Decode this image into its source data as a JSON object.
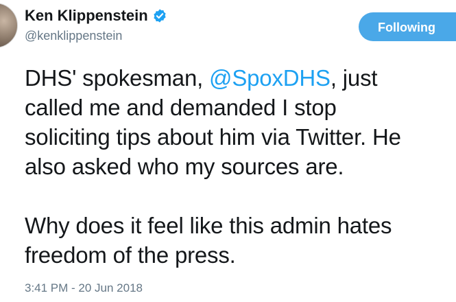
{
  "author": {
    "name": "Ken Klippenstein",
    "handle": "@kenklippenstein",
    "verified": true
  },
  "follow_button": {
    "label": "Following",
    "color": "#4aa8e8"
  },
  "tweet": {
    "line1_before": "DHS' spokesman, ",
    "line1_mention": "@SpoxDHS",
    "line1_after": ", just",
    "line2": "called me and demanded I stop",
    "line3": "soliciting tips about him via Twitter. He",
    "line4": "also asked who my sources are.",
    "line5": "Why does it feel like this admin hates",
    "line6": "freedom of the press."
  },
  "timestamp": "3:41 PM - 20 Jun 2018",
  "colors": {
    "mention": "#1da1f2",
    "secondary_text": "#657786",
    "verified_badge": "#1da1f2"
  }
}
